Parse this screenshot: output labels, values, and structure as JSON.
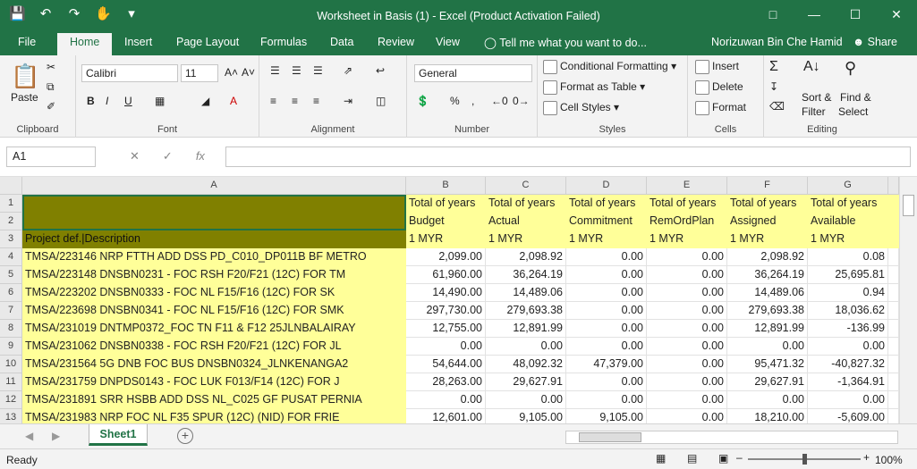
{
  "window": {
    "title": "Worksheet in Basis (1) - Excel (Product Activation Failed)",
    "user": "Norizuwan Bin Che Hamid",
    "share": "Share"
  },
  "tabs": [
    "File",
    "Home",
    "Insert",
    "Page Layout",
    "Formulas",
    "Data",
    "Review",
    "View"
  ],
  "active_tab": "Home",
  "tell_me": "Tell me what you want to do...",
  "ribbon": {
    "clipboard": {
      "label": "Clipboard",
      "paste": "Paste"
    },
    "font": {
      "label": "Font",
      "name": "Calibri",
      "size": "11"
    },
    "alignment": {
      "label": "Alignment"
    },
    "number": {
      "label": "Number",
      "format": "General"
    },
    "styles": {
      "label": "Styles",
      "conditional": "Conditional Formatting",
      "table": "Format as Table",
      "cell": "Cell Styles"
    },
    "cells": {
      "label": "Cells",
      "insert": "Insert",
      "delete": "Delete",
      "format": "Format"
    },
    "editing": {
      "label": "Editing",
      "sort": "Sort &",
      "filter": "Filter",
      "find": "Find &",
      "select": "Select"
    }
  },
  "namebox": "A1",
  "columns": [
    "A",
    "B",
    "C",
    "D",
    "E",
    "F",
    "G"
  ],
  "header_rows": [
    [
      "",
      "Total of years",
      "Total of years",
      "Total of years",
      "Total of years",
      "Total of years",
      "Total of years"
    ],
    [
      "",
      "Budget",
      "Actual",
      "Commitment",
      "RemOrdPlan",
      "Assigned",
      "Available"
    ],
    [
      "Project def.|Description",
      "1 MYR",
      "1 MYR",
      "1 MYR",
      "1 MYR",
      "1 MYR",
      "1 MYR"
    ]
  ],
  "rows": [
    [
      "TMSA/223146  NRP FTTH ADD DSS PD_C010_DP011B BF METRO",
      "2,099.00",
      "2,098.92",
      "0.00",
      "0.00",
      "2,098.92",
      "0.08"
    ],
    [
      "TMSA/223148  DNSBN0231 - FOC RSH F20/F21 (12C) FOR TM",
      "61,960.00",
      "36,264.19",
      "0.00",
      "0.00",
      "36,264.19",
      "25,695.81"
    ],
    [
      "TMSA/223202  DNSBN0333 - FOC NL F15/F16 (12C) FOR SK",
      "14,490.00",
      "14,489.06",
      "0.00",
      "0.00",
      "14,489.06",
      "0.94"
    ],
    [
      "TMSA/223698  DNSBN0341 - FOC NL F15/F16 (12C) FOR SMK",
      "297,730.00",
      "279,693.38",
      "0.00",
      "0.00",
      "279,693.38",
      "18,036.62"
    ],
    [
      "TMSA/231019  DNTMP0372_FOC TN F11 & F12 25JLNBALAIRAY",
      "12,755.00",
      "12,891.99",
      "0.00",
      "0.00",
      "12,891.99",
      "-136.99"
    ],
    [
      "TMSA/231062  DNSBN0338 - FOC RSH F20/F21 (12C) FOR JL",
      "0.00",
      "0.00",
      "0.00",
      "0.00",
      "0.00",
      "0.00"
    ],
    [
      "TMSA/231564  5G DNB FOC BUS DNSBN0324_JLNKENANGA2",
      "54,644.00",
      "48,092.32",
      "47,379.00",
      "0.00",
      "95,471.32",
      "-40,827.32"
    ],
    [
      "TMSA/231759  DNPDS0143 - FOC LUK F013/F14 (12C) FOR J",
      "28,263.00",
      "29,627.91",
      "0.00",
      "0.00",
      "29,627.91",
      "-1,364.91"
    ],
    [
      "TMSA/231891  SRR HSBB ADD DSS NL_C025 GF PUSAT PERNIA",
      "0.00",
      "0.00",
      "0.00",
      "0.00",
      "0.00",
      "0.00"
    ],
    [
      "TMSA/231983  NRP FOC NL F35 SPUR (12C) (NID) FOR FRIE",
      "12,601.00",
      "9,105.00",
      "9,105.00",
      "0.00",
      "18,210.00",
      "-5,609.00"
    ]
  ],
  "sheet_tab": "Sheet1",
  "status": {
    "ready": "Ready",
    "zoom": "100%"
  }
}
